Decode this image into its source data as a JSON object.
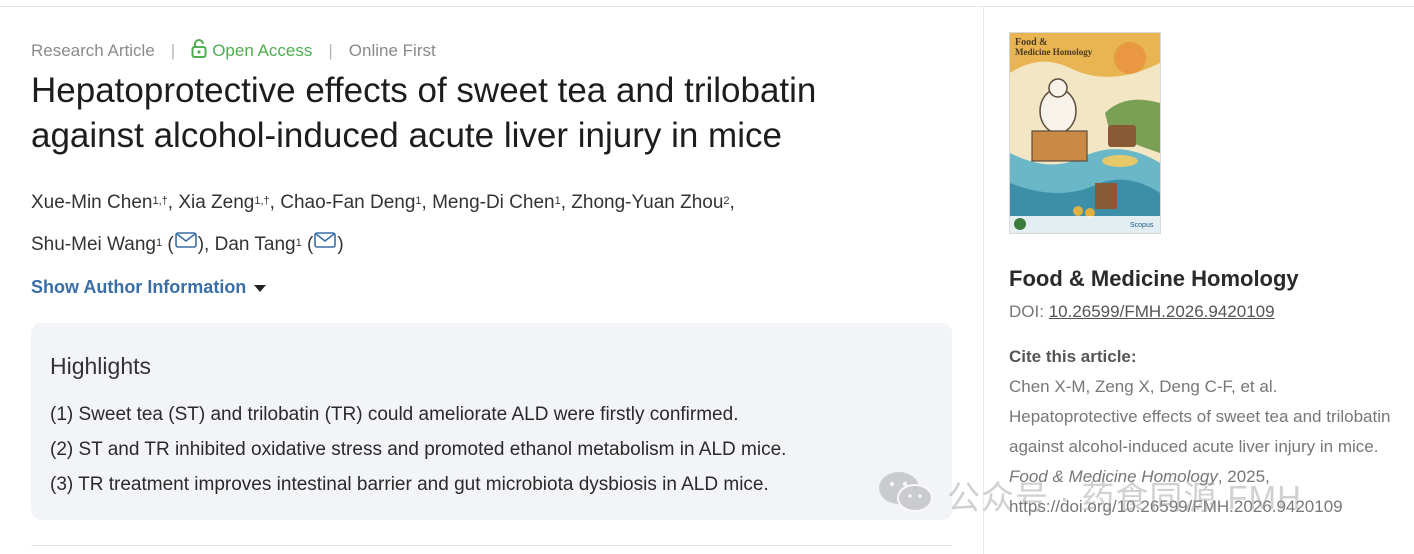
{
  "article": {
    "type": "Research Article",
    "access": "Open Access",
    "status": "Online First",
    "title_line1": "Hepatoprotective effects of sweet tea and trilobatin",
    "title_line2": "against alcohol-induced acute liver injury in mice",
    "authors": [
      {
        "name": "Xue-Min Chen",
        "sup": "1,†"
      },
      {
        "name": "Xia Zeng",
        "sup": "1,†"
      },
      {
        "name": "Chao-Fan Deng",
        "sup": "1"
      },
      {
        "name": "Meng-Di Chen",
        "sup": "1"
      },
      {
        "name": "Zhong-Yuan Zhou",
        "sup": "2"
      },
      {
        "name": "Shu-Mei Wang",
        "sup": "1"
      },
      {
        "name": "Dan Tang",
        "sup": "1"
      }
    ],
    "show_author_info": "Show Author Information"
  },
  "highlights": {
    "heading": "Highlights",
    "items": [
      "(1) Sweet tea (ST) and trilobatin (TR) could ameliorate ALD were firstly confirmed.",
      "(2) ST and TR inhibited oxidative stress and promoted ethanol metabolism in ALD mice.",
      "(3) TR treatment improves intestinal barrier and gut microbiota dysbiosis in ALD mice."
    ]
  },
  "sidebar": {
    "cover_title_line1": "Food &",
    "cover_title_line2": "Medicine Homology",
    "cover_logo": "Scopus",
    "journal": "Food & Medicine Homology",
    "doi_label": "DOI:",
    "doi": "10.26599/FMH.2026.9420109",
    "cite_label": "Cite this article:",
    "cite_part1": "Chen X-M, Zeng X, Deng C-F, et al. Hepatoprotective effects of sweet tea and trilobatin against alcohol-induced acute liver injury in mice.",
    "cite_journal": "Food & Medicine Homology",
    "cite_part2": ", 2025, https://doi.org/10.26599/FMH.2026.9420109"
  },
  "watermark": {
    "text": "公众号 · 药食同源 FMH"
  },
  "colors": {
    "open_access": "#4cae4f",
    "link": "#3a6ea5",
    "highlight_bg": "#f3f4f7"
  }
}
